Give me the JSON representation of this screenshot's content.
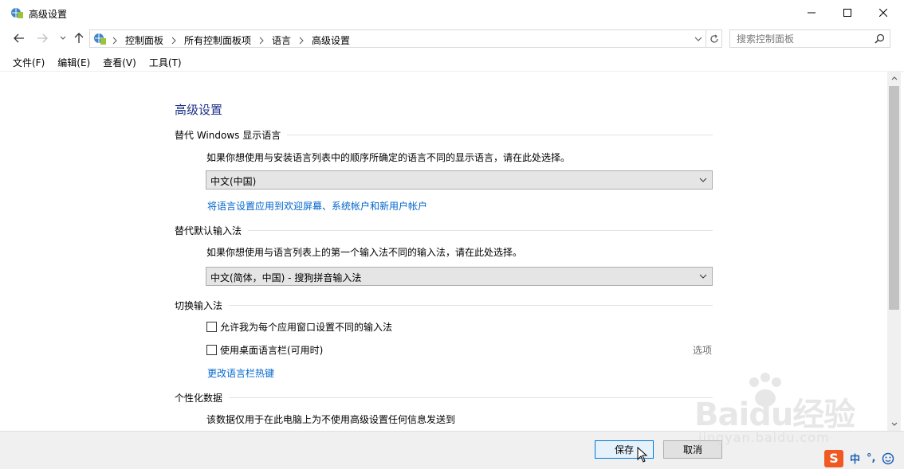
{
  "window": {
    "title": "高级设置"
  },
  "address": {
    "crumbs": [
      "控制面板",
      "所有控制面板项",
      "语言",
      "高级设置"
    ]
  },
  "search": {
    "placeholder": "搜索控制面板"
  },
  "menu": [
    "文件(F)",
    "编辑(E)",
    "查看(V)",
    "工具(T)"
  ],
  "page": {
    "title": "高级设置",
    "display_lang": {
      "heading": "替代 Windows 显示语言",
      "desc": "如果你想使用与安装语言列表中的顺序所确定的语言不同的显示语言，请在此处选择。",
      "selected": "中文(中国)",
      "link": "将语言设置应用到欢迎屏幕、系统帐户和新用户帐户"
    },
    "default_input": {
      "heading": "替代默认输入法",
      "desc": "如果你想使用与语言列表上的第一个输入法不同的输入法，请在此处选择。",
      "selected": "中文(简体，中国) - 搜狗拼音输入法"
    },
    "switch_input": {
      "heading": "切换输入法",
      "option1": "允许我为每个应用窗口设置不同的输入法",
      "option2": "使用桌面语言栏(可用时)",
      "options_link": "选项",
      "hotkey_link": "更改语言栏热键"
    },
    "personal_data": {
      "heading": "个性化数据",
      "desc": "该数据仅用于在此电脑上为不使用高级设置任何信息发送到"
    }
  },
  "footer": {
    "save": "保存",
    "cancel": "取消"
  },
  "tray": {
    "ime_mode": "中",
    "punct": "°,"
  },
  "watermark": {
    "brand": "Baidu经验",
    "url": "jingyan.baidu.com"
  },
  "colors": {
    "title_blue": "#1e3287",
    "link_blue": "#0066cc",
    "accent": "#0078d7"
  }
}
